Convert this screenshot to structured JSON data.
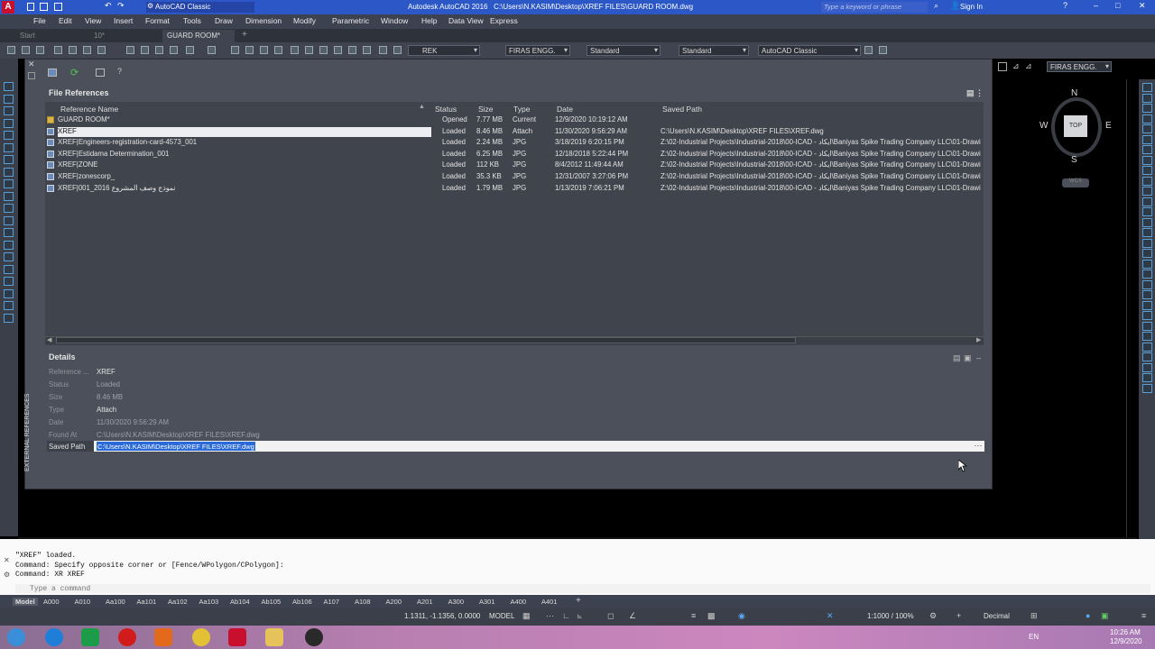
{
  "title_bar": {
    "workspace": "AutoCAD Classic",
    "title": "Autodesk AutoCAD 2016   C:\\Users\\N.KASIM\\Desktop\\XREF FILES\\GUARD ROOM.dwg",
    "search_placeholder": "Type a keyword or phrase",
    "sign_in": "Sign In"
  },
  "menu": [
    "File",
    "Edit",
    "View",
    "Insert",
    "Format",
    "Tools",
    "Draw",
    "Dimension",
    "Modify",
    "Parametric",
    "Window",
    "Help",
    "Data View",
    "Express"
  ],
  "doc_tabs": [
    "Start",
    "10*",
    "GUARD ROOM*"
  ],
  "toolbar": {
    "layer": "REK",
    "dim_style": "FIRAS ENGG.",
    "text_style": "Standard",
    "table_style": "Standard",
    "workspace": "AutoCAD Classic",
    "right_combo": "FIRAS ENGG."
  },
  "file_references": {
    "header": "File References",
    "columns": [
      "Reference Name",
      "Status",
      "Size",
      "Type",
      "Date",
      "Saved Path"
    ],
    "rows": [
      {
        "name": "GUARD ROOM*",
        "status": "Opened",
        "size": "7.77 MB",
        "type": "Current",
        "date": "12/9/2020 10:19:12 AM",
        "path": "",
        "icon": "folder"
      },
      {
        "name": "XREF",
        "status": "Loaded",
        "size": "8.46 MB",
        "type": "Attach",
        "date": "11/30/2020 9:56:29 AM",
        "path": "C:\\Users\\N.KASIM\\Desktop\\XREF FILES\\XREF.dwg",
        "icon": "dwg"
      },
      {
        "name": "XREF|Engineers-registration-card-4573_001",
        "status": "Loaded",
        "size": "2.24 MB",
        "type": "JPG",
        "date": "3/18/2019 6:20:15 PM",
        "path": "Z:\\02-Industrial Projects\\Industrial-2018\\00-ICAD - ايكاد\\Baniyas Spike Trading Company LLC\\01-Drawi",
        "icon": "img"
      },
      {
        "name": "XREF|Estidama Determination_001",
        "status": "Loaded",
        "size": "6.25 MB",
        "type": "JPG",
        "date": "12/18/2018 5:22:44 PM",
        "path": "Z:\\02-Industrial Projects\\Industrial-2018\\00-ICAD - ايكاد\\Baniyas Spike Trading Company LLC\\01-Drawi",
        "icon": "img"
      },
      {
        "name": "XREF|ZONE",
        "status": "Loaded",
        "size": "112 KB",
        "type": "JPG",
        "date": "8/4/2012 11:49:44 AM",
        "path": "Z:\\02-Industrial Projects\\Industrial-2018\\00-ICAD - ايكاد\\Baniyas Spike Trading Company LLC\\01-Drawi",
        "icon": "img"
      },
      {
        "name": "XREF|zonescorp_",
        "status": "Loaded",
        "size": "35.3 KB",
        "type": "JPG",
        "date": "12/31/2007 3:27:06 PM",
        "path": "Z:\\02-Industrial Projects\\Industrial-2018\\00-ICAD - ايكاد\\Baniyas Spike Trading Company LLC\\01-Drawi",
        "icon": "img"
      },
      {
        "name": "XREF|001_2016 نموذج وصف المشروع",
        "status": "Loaded",
        "size": "1.79 MB",
        "type": "JPG",
        "date": "1/13/2019 7:06:21 PM",
        "path": "Z:\\02-Industrial Projects\\Industrial-2018\\00-ICAD - ايكاد\\Baniyas Spike Trading Company LLC\\01-Drawi",
        "icon": "img"
      }
    ]
  },
  "details": {
    "header": "Details",
    "fields": [
      {
        "label": "Reference ...",
        "value": "XREF",
        "bright": true
      },
      {
        "label": "Status",
        "value": "Loaded",
        "bright": false
      },
      {
        "label": "Size",
        "value": "8.46 MB",
        "bright": false
      },
      {
        "label": "Type",
        "value": "Attach",
        "bright": true
      },
      {
        "label": "Date",
        "value": "11/30/2020 9:56:29 AM",
        "bright": false
      },
      {
        "label": "Found At",
        "value": "C:\\Users\\N.KASIM\\Desktop\\XREF FILES\\XREF.dwg",
        "bright": false
      }
    ],
    "saved_path_label": "Saved Path",
    "saved_path_value": "C:\\Users\\N.KASIM\\Desktop\\XREF FILES\\XREF.dwg"
  },
  "panel_vertical_label": "EXTERNAL REFERENCES",
  "viewcube": {
    "n": "N",
    "s": "S",
    "e": "E",
    "w": "W",
    "top": "TOP",
    "wcs": "WCS"
  },
  "command": {
    "lines": "\"XREF\" loaded.\nCommand: Specify opposite corner or [Fence/WPolygon/CPolygon]:\nCommand: XR XREF",
    "placeholder": "Type a command"
  },
  "layout_tabs": [
    "Model",
    "A000",
    "A010",
    "Aa100",
    "Aa101",
    "Aa102",
    "Aa103",
    "Ab104",
    "Ab105",
    "Ab106",
    "A107",
    "A108",
    "A200",
    "A201",
    "A300",
    "A301",
    "A400",
    "A401"
  ],
  "status_bar": {
    "coords": "1.1311, -1.1356, 0.0000",
    "model": "MODEL",
    "scale": "1:1000 / 100%",
    "units": "Decimal"
  },
  "taskbar": {
    "lang": "EN",
    "time": "10:26 AM",
    "date": "12/9/2020"
  }
}
